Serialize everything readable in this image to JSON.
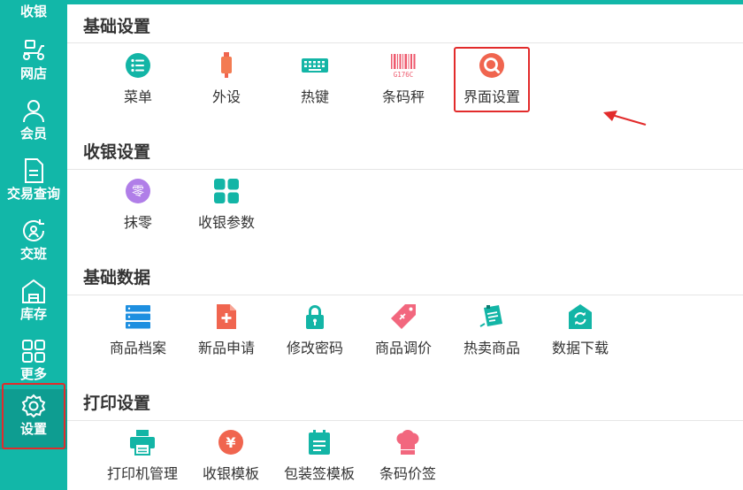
{
  "sidebar": {
    "items": [
      {
        "label": "收银",
        "icon": "cashier-icon"
      },
      {
        "label": "网店",
        "icon": "scooter-icon"
      },
      {
        "label": "会员",
        "icon": "user-icon"
      },
      {
        "label": "交易查询",
        "icon": "document-icon"
      },
      {
        "label": "交班",
        "icon": "shift-icon"
      },
      {
        "label": "库存",
        "icon": "warehouse-icon"
      },
      {
        "label": "更多",
        "icon": "grid-icon"
      },
      {
        "label": "设置",
        "icon": "gear-icon"
      }
    ],
    "active": "设置"
  },
  "sections": [
    {
      "title": "基础设置",
      "items": [
        {
          "label": "菜单",
          "icon": "menu-list-icon"
        },
        {
          "label": "外设",
          "icon": "usb-device-icon"
        },
        {
          "label": "热键",
          "icon": "keyboard-icon"
        },
        {
          "label": "条码秤",
          "icon": "barcode-icon",
          "code": "G176C"
        },
        {
          "label": "界面设置",
          "icon": "interface-search-icon"
        }
      ]
    },
    {
      "title": "收银设置",
      "items": [
        {
          "label": "抹零",
          "icon": "zero-icon",
          "glyph": "零"
        },
        {
          "label": "收银参数",
          "icon": "four-squares-icon"
        }
      ]
    },
    {
      "title": "基础数据",
      "items": [
        {
          "label": "商品档案",
          "icon": "server-icon"
        },
        {
          "label": "新品申请",
          "icon": "new-file-icon"
        },
        {
          "label": "修改密码",
          "icon": "lock-icon"
        },
        {
          "label": "商品调价",
          "icon": "price-tag-icon"
        },
        {
          "label": "热卖商品",
          "icon": "hot-notes-icon"
        },
        {
          "label": "数据下载",
          "icon": "sync-icon"
        }
      ]
    },
    {
      "title": "打印设置",
      "items": [
        {
          "label": "打印机管理",
          "icon": "printer-icon"
        },
        {
          "label": "收银模板",
          "icon": "yen-icon",
          "glyph": "¥"
        },
        {
          "label": "包装签模板",
          "icon": "calendar-icon"
        },
        {
          "label": "条码价签",
          "icon": "chef-hat-icon"
        }
      ]
    }
  ],
  "colors": {
    "sidebar": "#12b7a8",
    "teal_icon": "#13b5a6",
    "red_icon": "#f0654f",
    "purple_icon": "#b07ee8",
    "highlight": "#e22b2b"
  }
}
